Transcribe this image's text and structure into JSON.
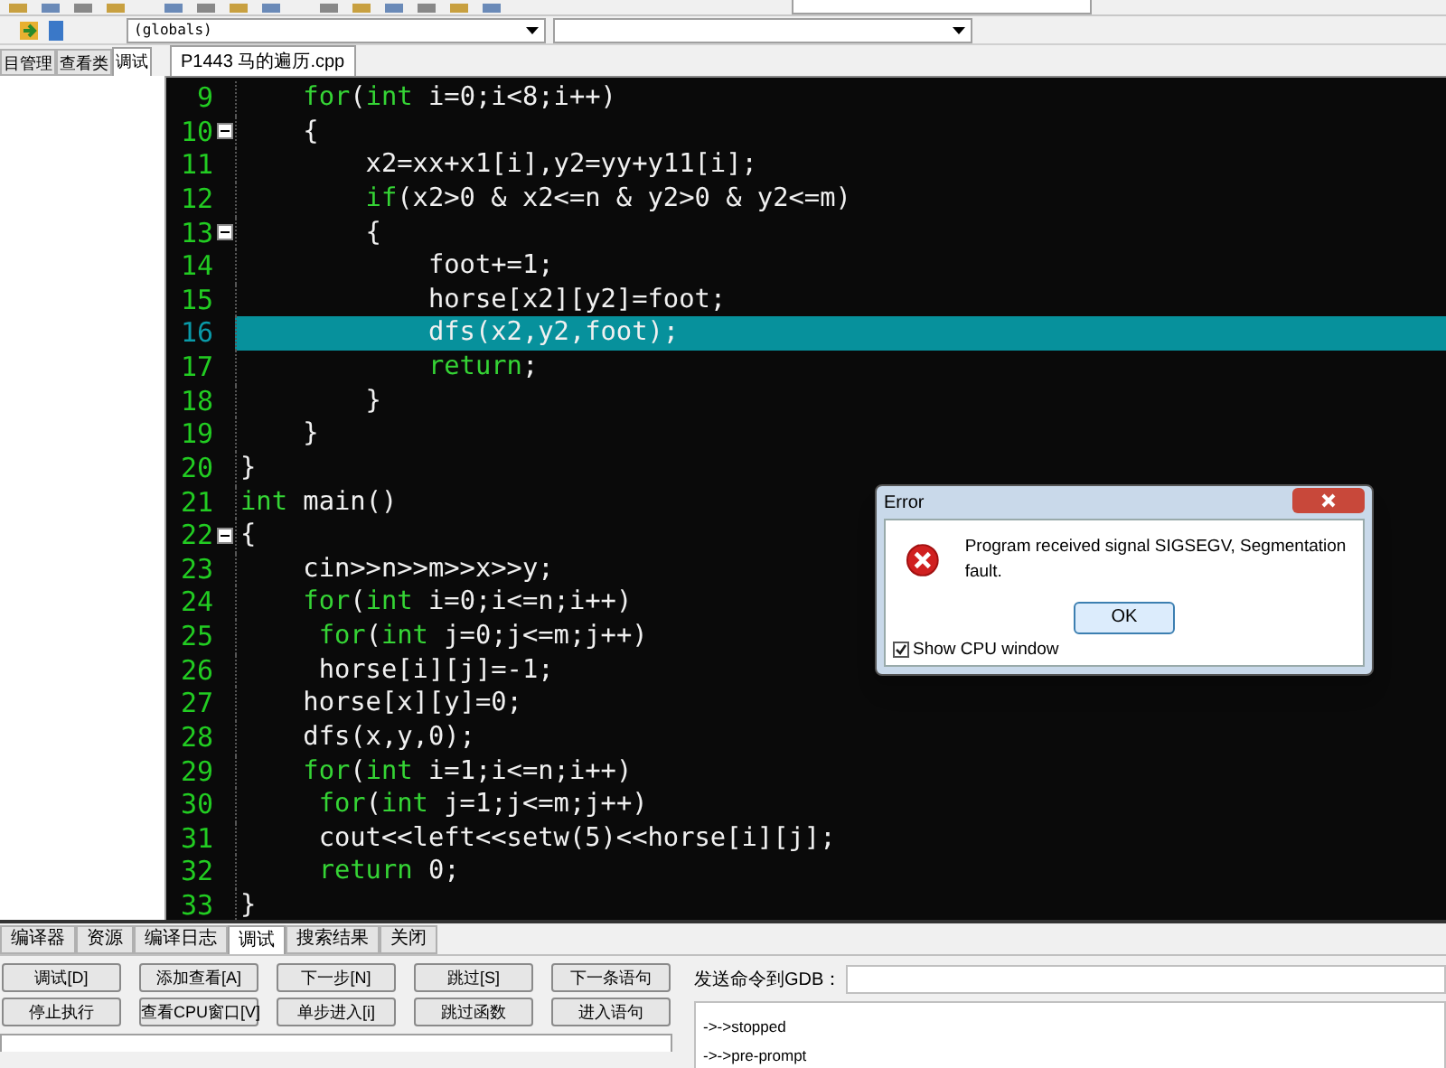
{
  "toolbar": {
    "scope_combo": "(globals)"
  },
  "side_tabs": [
    {
      "label": "目管理",
      "selected": false
    },
    {
      "label": "查看类",
      "selected": false
    },
    {
      "label": "调试",
      "selected": true
    }
  ],
  "editor_tabs": [
    {
      "label": "P1443 马的遍历.cpp",
      "selected": true
    }
  ],
  "code_lines": [
    {
      "number": "9",
      "fold": false,
      "highlighted": false,
      "segments": [
        {
          "kind": "keyword",
          "text": "    for"
        },
        {
          "kind": "plain",
          "text": "("
        },
        {
          "kind": "keyword",
          "text": "int"
        },
        {
          "kind": "plain",
          "text": " i=0;i<8;i++)"
        }
      ]
    },
    {
      "number": "10",
      "fold": true,
      "highlighted": false,
      "segments": [
        {
          "kind": "plain",
          "text": "    {"
        }
      ]
    },
    {
      "number": "11",
      "fold": false,
      "highlighted": false,
      "segments": [
        {
          "kind": "plain",
          "text": "        x2=xx+x1[i],y2=yy+y11[i];"
        }
      ]
    },
    {
      "number": "12",
      "fold": false,
      "highlighted": false,
      "segments": [
        {
          "kind": "keyword",
          "text": "        if"
        },
        {
          "kind": "plain",
          "text": "(x2>0 & x2<=n & y2>0 & y2<=m)"
        }
      ]
    },
    {
      "number": "13",
      "fold": true,
      "highlighted": false,
      "segments": [
        {
          "kind": "plain",
          "text": "        {"
        }
      ]
    },
    {
      "number": "14",
      "fold": false,
      "highlighted": false,
      "segments": [
        {
          "kind": "plain",
          "text": "            foot+=1;"
        }
      ]
    },
    {
      "number": "15",
      "fold": false,
      "highlighted": false,
      "segments": [
        {
          "kind": "plain",
          "text": "            horse[x2][y2]=foot;"
        }
      ]
    },
    {
      "number": "16",
      "fold": false,
      "highlighted": true,
      "segments": [
        {
          "kind": "plain",
          "text": "            dfs(x2,y2,foot);"
        }
      ]
    },
    {
      "number": "17",
      "fold": false,
      "highlighted": false,
      "segments": [
        {
          "kind": "keyword",
          "text": "            return"
        },
        {
          "kind": "plain",
          "text": ";"
        }
      ]
    },
    {
      "number": "18",
      "fold": false,
      "highlighted": false,
      "segments": [
        {
          "kind": "plain",
          "text": "        }"
        }
      ]
    },
    {
      "number": "19",
      "fold": false,
      "highlighted": false,
      "segments": [
        {
          "kind": "plain",
          "text": "    }"
        }
      ]
    },
    {
      "number": "20",
      "fold": false,
      "highlighted": false,
      "segments": [
        {
          "kind": "plain",
          "text": "}"
        }
      ]
    },
    {
      "number": "21",
      "fold": false,
      "highlighted": false,
      "segments": [
        {
          "kind": "keyword",
          "text": "int"
        },
        {
          "kind": "plain",
          "text": " main()"
        }
      ]
    },
    {
      "number": "22",
      "fold": true,
      "highlighted": false,
      "segments": [
        {
          "kind": "plain",
          "text": "{"
        }
      ]
    },
    {
      "number": "23",
      "fold": false,
      "highlighted": false,
      "segments": [
        {
          "kind": "plain",
          "text": "    cin>>n>>m>>x>>y;"
        }
      ]
    },
    {
      "number": "24",
      "fold": false,
      "highlighted": false,
      "segments": [
        {
          "kind": "keyword",
          "text": "    for"
        },
        {
          "kind": "plain",
          "text": "("
        },
        {
          "kind": "keyword",
          "text": "int"
        },
        {
          "kind": "plain",
          "text": " i=0;i<=n;i++)"
        }
      ]
    },
    {
      "number": "25",
      "fold": false,
      "highlighted": false,
      "segments": [
        {
          "kind": "keyword",
          "text": "     for"
        },
        {
          "kind": "plain",
          "text": "("
        },
        {
          "kind": "keyword",
          "text": "int"
        },
        {
          "kind": "plain",
          "text": " j=0;j<=m;j++)"
        }
      ]
    },
    {
      "number": "26",
      "fold": false,
      "highlighted": false,
      "segments": [
        {
          "kind": "plain",
          "text": "     horse[i][j]=-1;"
        }
      ]
    },
    {
      "number": "27",
      "fold": false,
      "highlighted": false,
      "segments": [
        {
          "kind": "plain",
          "text": "    horse[x][y]=0;"
        }
      ]
    },
    {
      "number": "28",
      "fold": false,
      "highlighted": false,
      "segments": [
        {
          "kind": "plain",
          "text": "    dfs(x,y,0);"
        }
      ]
    },
    {
      "number": "29",
      "fold": false,
      "highlighted": false,
      "segments": [
        {
          "kind": "keyword",
          "text": "    for"
        },
        {
          "kind": "plain",
          "text": "("
        },
        {
          "kind": "keyword",
          "text": "int"
        },
        {
          "kind": "plain",
          "text": " i=1;i<=n;i++)"
        }
      ]
    },
    {
      "number": "30",
      "fold": false,
      "highlighted": false,
      "segments": [
        {
          "kind": "keyword",
          "text": "     for"
        },
        {
          "kind": "plain",
          "text": "("
        },
        {
          "kind": "keyword",
          "text": "int"
        },
        {
          "kind": "plain",
          "text": " j=1;j<=m;j++)"
        }
      ]
    },
    {
      "number": "31",
      "fold": false,
      "highlighted": false,
      "segments": [
        {
          "kind": "plain",
          "text": "     cout<<left<<setw(5)<<horse[i][j];"
        }
      ]
    },
    {
      "number": "32",
      "fold": false,
      "highlighted": false,
      "segments": [
        {
          "kind": "keyword",
          "text": "     return"
        },
        {
          "kind": "plain",
          "text": " 0;"
        }
      ]
    },
    {
      "number": "33",
      "fold": false,
      "highlighted": false,
      "segments": [
        {
          "kind": "plain",
          "text": "}"
        }
      ]
    }
  ],
  "bottom_tabs": [
    {
      "label": "编译器",
      "selected": false
    },
    {
      "label": "资源",
      "selected": false
    },
    {
      "label": "编译日志",
      "selected": false
    },
    {
      "label": "调试",
      "selected": true
    },
    {
      "label": "搜索结果",
      "selected": false
    },
    {
      "label": "关闭",
      "selected": false
    }
  ],
  "debug_buttons": [
    [
      "调试[D]",
      "添加查看[A]",
      "下一步[N]",
      "跳过[S]",
      "下一条语句"
    ],
    [
      "停止执行",
      "查看CPU窗口[V]",
      "单步进入[i]",
      "跳过函数",
      "进入语句"
    ]
  ],
  "gdb": {
    "label": "发送命令到GDB：",
    "output": [
      "->->stopped",
      "->->pre-prompt"
    ]
  },
  "dialog": {
    "title": "Error",
    "message": "Program received signal SIGSEGV, Segmentation fault.",
    "ok": "OK",
    "checkbox": {
      "label": "Show CPU window",
      "checked": true
    }
  }
}
